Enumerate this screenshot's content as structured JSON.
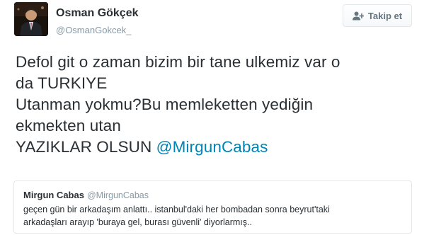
{
  "tweet": {
    "author": {
      "display_name": "Osman Gökçek",
      "screen_name": "@OsmanGokcek_",
      "avatar_icon": "profile-photo"
    },
    "follow_button": {
      "label": "Takip et",
      "icon": "add-user-icon"
    },
    "text": {
      "line1": "Defol git o zaman  bizim bir tane ulkemiz var o",
      "line2": "da TURKIYE",
      "line3": "Utanman yokmu?Bu memleketten yediğin",
      "line4": "ekmekten utan",
      "line5_prefix": "YAZIKLAR OLSUN ",
      "mention": "@MirgunCabas"
    },
    "quoted_tweet": {
      "display_name": "Mirgun Cabas",
      "screen_name": "@MirgunCabas",
      "text_line1": "geçen gün bir arkadaşım anlattı.. istanbul'daki her bombadan sonra beyrut'taki",
      "text_line2": "arkadaşları arayıp 'buraya gel, burası güvenli' diyorlarmış.."
    }
  },
  "colors": {
    "text": "#292f33",
    "secondary": "#8899a6",
    "link": "#0084b4",
    "border": "#e1e8ed",
    "button_text": "#66757f"
  }
}
